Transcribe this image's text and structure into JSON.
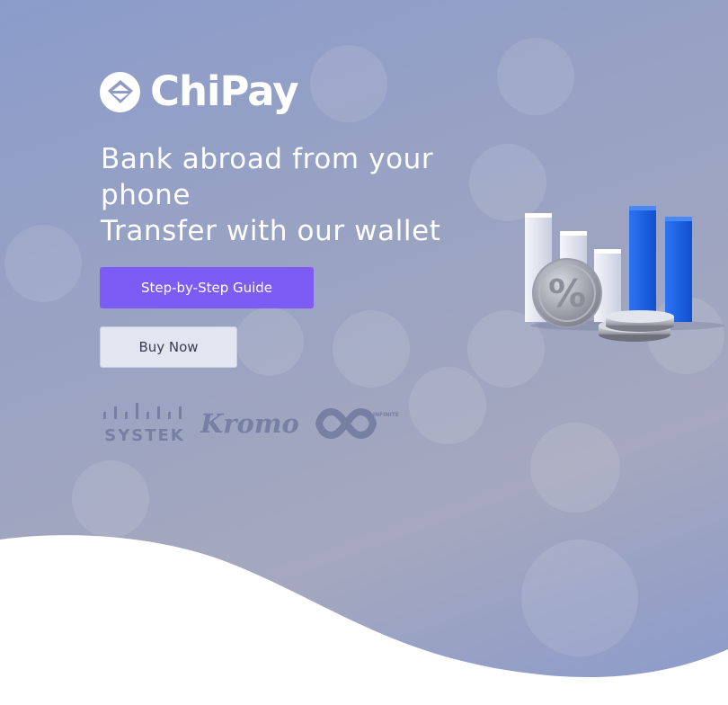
{
  "brand": {
    "name": "ChiPay",
    "logo_icon": "diamond-logo-icon"
  },
  "hero": {
    "headline_lines": [
      "Bank abroad from your",
      "phone",
      "Transfer with our wallet"
    ],
    "primary_button": "Step-by-Step Guide",
    "secondary_button": "Buy Now"
  },
  "partners": [
    {
      "name": "SYSTEK",
      "icon": "systek-logo"
    },
    {
      "name": "Kromo",
      "icon": "kromo-logo"
    },
    {
      "name": "INFINITE",
      "icon": "infinity-logo"
    }
  ],
  "illustration": {
    "description_icon": "bar-chart-percent-coin-icon",
    "coin_symbol": "%"
  },
  "colors": {
    "primary_button": "#7c5cf5",
    "secondary_button": "#e3e6f0",
    "bars_white": "#e9ebf3",
    "bars_blue": "#1f63e8",
    "partner_logo": "#7780a3"
  }
}
